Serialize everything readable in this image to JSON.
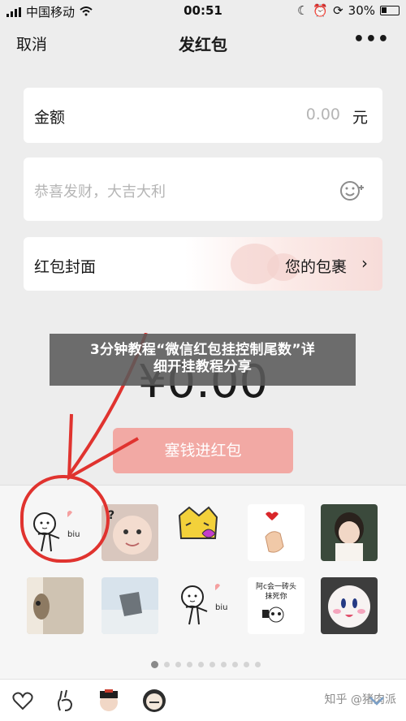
{
  "status": {
    "carrier": "中国移动",
    "time": "00:51",
    "battery": "30%"
  },
  "nav": {
    "cancel": "取消",
    "title": "发红包",
    "more": "•••"
  },
  "amount": {
    "label": "金额",
    "value": "0.00",
    "unit": "元"
  },
  "greeting": {
    "placeholder": "恭喜发财，大吉大利"
  },
  "cover": {
    "label": "红包封面",
    "value": "您的包裹",
    "chevron": "›"
  },
  "big_amount": "¥0.00",
  "stuff_button": "塞钱进红包",
  "overlay": {
    "line1": "3分钟教程“微信红包挂控制尾数”详",
    "line2": "细开挂教程分享"
  },
  "stickers": {
    "text_sticker": "阿c会一砖头\n抹死你",
    "biu": "biu",
    "question": "?"
  },
  "pager": {
    "count": 10,
    "active": 0
  },
  "watermark": "知乎 @猪肉派",
  "colors": {
    "accent": "#f2a9a4",
    "annotation_red": "#e0332f"
  },
  "icons": [
    "signal-icon",
    "wifi-icon",
    "battery-icon",
    "emoji-icon",
    "heart-icon",
    "gesture-icon",
    "collapse-icon"
  ]
}
